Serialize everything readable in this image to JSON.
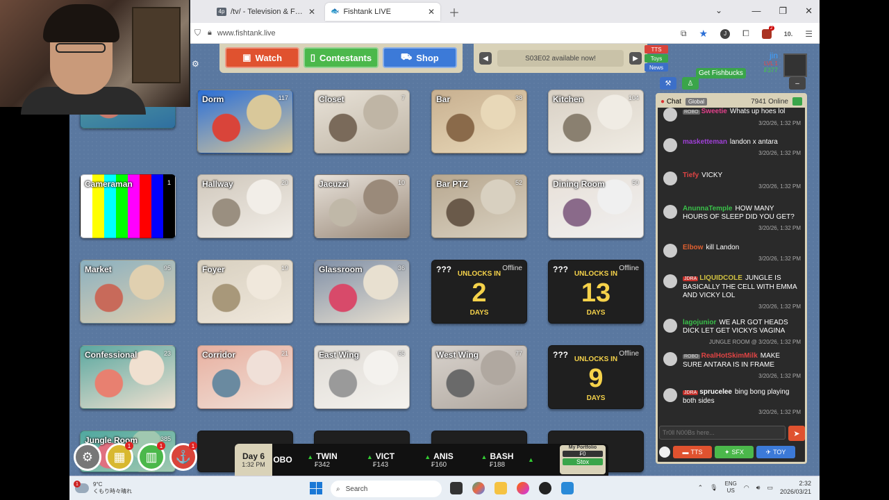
{
  "browser": {
    "tabs": [
      {
        "label": "/tv/ - Television & Film » Thread",
        "favicon": "4p"
      },
      {
        "label": "Fishtank LIVE"
      }
    ],
    "url": "www.fishtank.live"
  },
  "nav": {
    "watch": "Watch",
    "contestants": "Contestants",
    "shop": "Shop"
  },
  "news": {
    "text": "S03E02 available now!",
    "buttons": [
      "TTS",
      "Toys",
      "News"
    ]
  },
  "user": {
    "name": "jin",
    "level": "LVL 1",
    "points": "₣377",
    "get_fishbucks": "Get Fishbucks"
  },
  "cameras": [
    {
      "title": "",
      "views": ""
    },
    {
      "title": "Dorm",
      "views": "117"
    },
    {
      "title": "Closet",
      "views": "7"
    },
    {
      "title": "Bar",
      "views": "38"
    },
    {
      "title": "Kitchen",
      "views": "104"
    },
    {
      "title": "Cameraman",
      "views": "1"
    },
    {
      "title": "Hallway",
      "views": "20"
    },
    {
      "title": "Jacuzzi",
      "views": "10"
    },
    {
      "title": "Bar PTZ",
      "views": "52"
    },
    {
      "title": "Dining Room",
      "views": "50"
    },
    {
      "title": "Market",
      "views": "95"
    },
    {
      "title": "Foyer",
      "views": "19"
    },
    {
      "title": "Glassroom",
      "views": "36"
    },
    {
      "title": "Confessional",
      "views": "23"
    },
    {
      "title": "Corridor",
      "views": "21"
    },
    {
      "title": "East Wing",
      "views": "65"
    },
    {
      "title": "West Wing",
      "views": "77"
    },
    {
      "title": "Jungle Room",
      "views": "385"
    }
  ],
  "locked": [
    {
      "q": "???",
      "status": "Offline",
      "unlocks": "UNLOCKS IN",
      "num": "2",
      "unit": "DAYS"
    },
    {
      "q": "???",
      "status": "Offline",
      "unlocks": "UNLOCKS IN",
      "num": "13",
      "unit": "DAYS"
    },
    {
      "q": "???",
      "status": "Offline",
      "unlocks": "UNLOCKS IN",
      "num": "9",
      "unit": "DAYS"
    }
  ],
  "ticker": {
    "day": "Day 6",
    "time": "1:32 PM",
    "stocks": [
      {
        "sym": "OBO",
        "price": ""
      },
      {
        "sym": "TWIN",
        "price": "₣342"
      },
      {
        "sym": "VICT",
        "price": "₣143"
      },
      {
        "sym": "ANIS",
        "price": "₣160"
      },
      {
        "sym": "BASH",
        "price": "₣188"
      }
    ],
    "portfolio_label": "My Portfolio",
    "portfolio_value": "₣0",
    "stox": "Stox"
  },
  "chat": {
    "tab": "Chat",
    "global": "Global",
    "online": "7941 Online",
    "messages": [
      {
        "tag": "ROBO",
        "user": "Sweetie",
        "text": "Whats up hoes lol",
        "ts": "3/20/26, 1:32 PM",
        "color": "#e0408a"
      },
      {
        "tag": "",
        "user": "masketteman",
        "text": "landon x antara",
        "ts": "3/20/26, 1:32 PM",
        "color": "#a040d8"
      },
      {
        "tag": "",
        "user": "Tiefy",
        "text": "VICKY",
        "ts": "3/20/26, 1:32 PM",
        "color": "#e04444"
      },
      {
        "tag": "",
        "user": "AnunnaTemple",
        "text": "HOW MANY HOURS OF SLEEP DID YOU GET?",
        "ts": "3/20/26, 1:32 PM",
        "color": "#3ac04a"
      },
      {
        "tag": "",
        "user": "Elbow",
        "text": "kill Landon",
        "ts": "3/20/26, 1:32 PM",
        "color": "#e06030"
      },
      {
        "tag": "JDRA",
        "user": "LIQUIDCOLE",
        "text": "JUNGLE IS BASICALLY THE CELL WITH EMMA AND VICKY LOL",
        "ts": "3/20/26, 1:32 PM",
        "color": "#d0c040"
      },
      {
        "tag": "",
        "user": "lagojunior",
        "text": "WE ALR GOT HEADS DICK LET GET VICKYS VAGINA",
        "ts": "JUNGLE ROOM @ 3/20/26, 1:32 PM",
        "color": "#3ac04a"
      },
      {
        "tag": "ROBO",
        "user": "RealHotSkimMilk",
        "text": "MAKE SURE ANTARA IS IN FRAME",
        "ts": "3/20/26, 1:32 PM",
        "color": "#e04444"
      },
      {
        "tag": "JDRA",
        "user": "sprucelee",
        "text": "bing bong playing both sides",
        "ts": "3/20/26, 1:32 PM",
        "color": "#ffffff"
      }
    ],
    "input_placeholder": "Tr0ll N00Bs here...",
    "tts": "TTS",
    "sfx": "SFX",
    "toy": "TOY"
  },
  "taskbar": {
    "temp": "9°C",
    "weather": "くもり時々晴れ",
    "search": "Search",
    "lang1": "ENG",
    "lang2": "US",
    "time": "2:32",
    "date": "2026/03/21"
  }
}
